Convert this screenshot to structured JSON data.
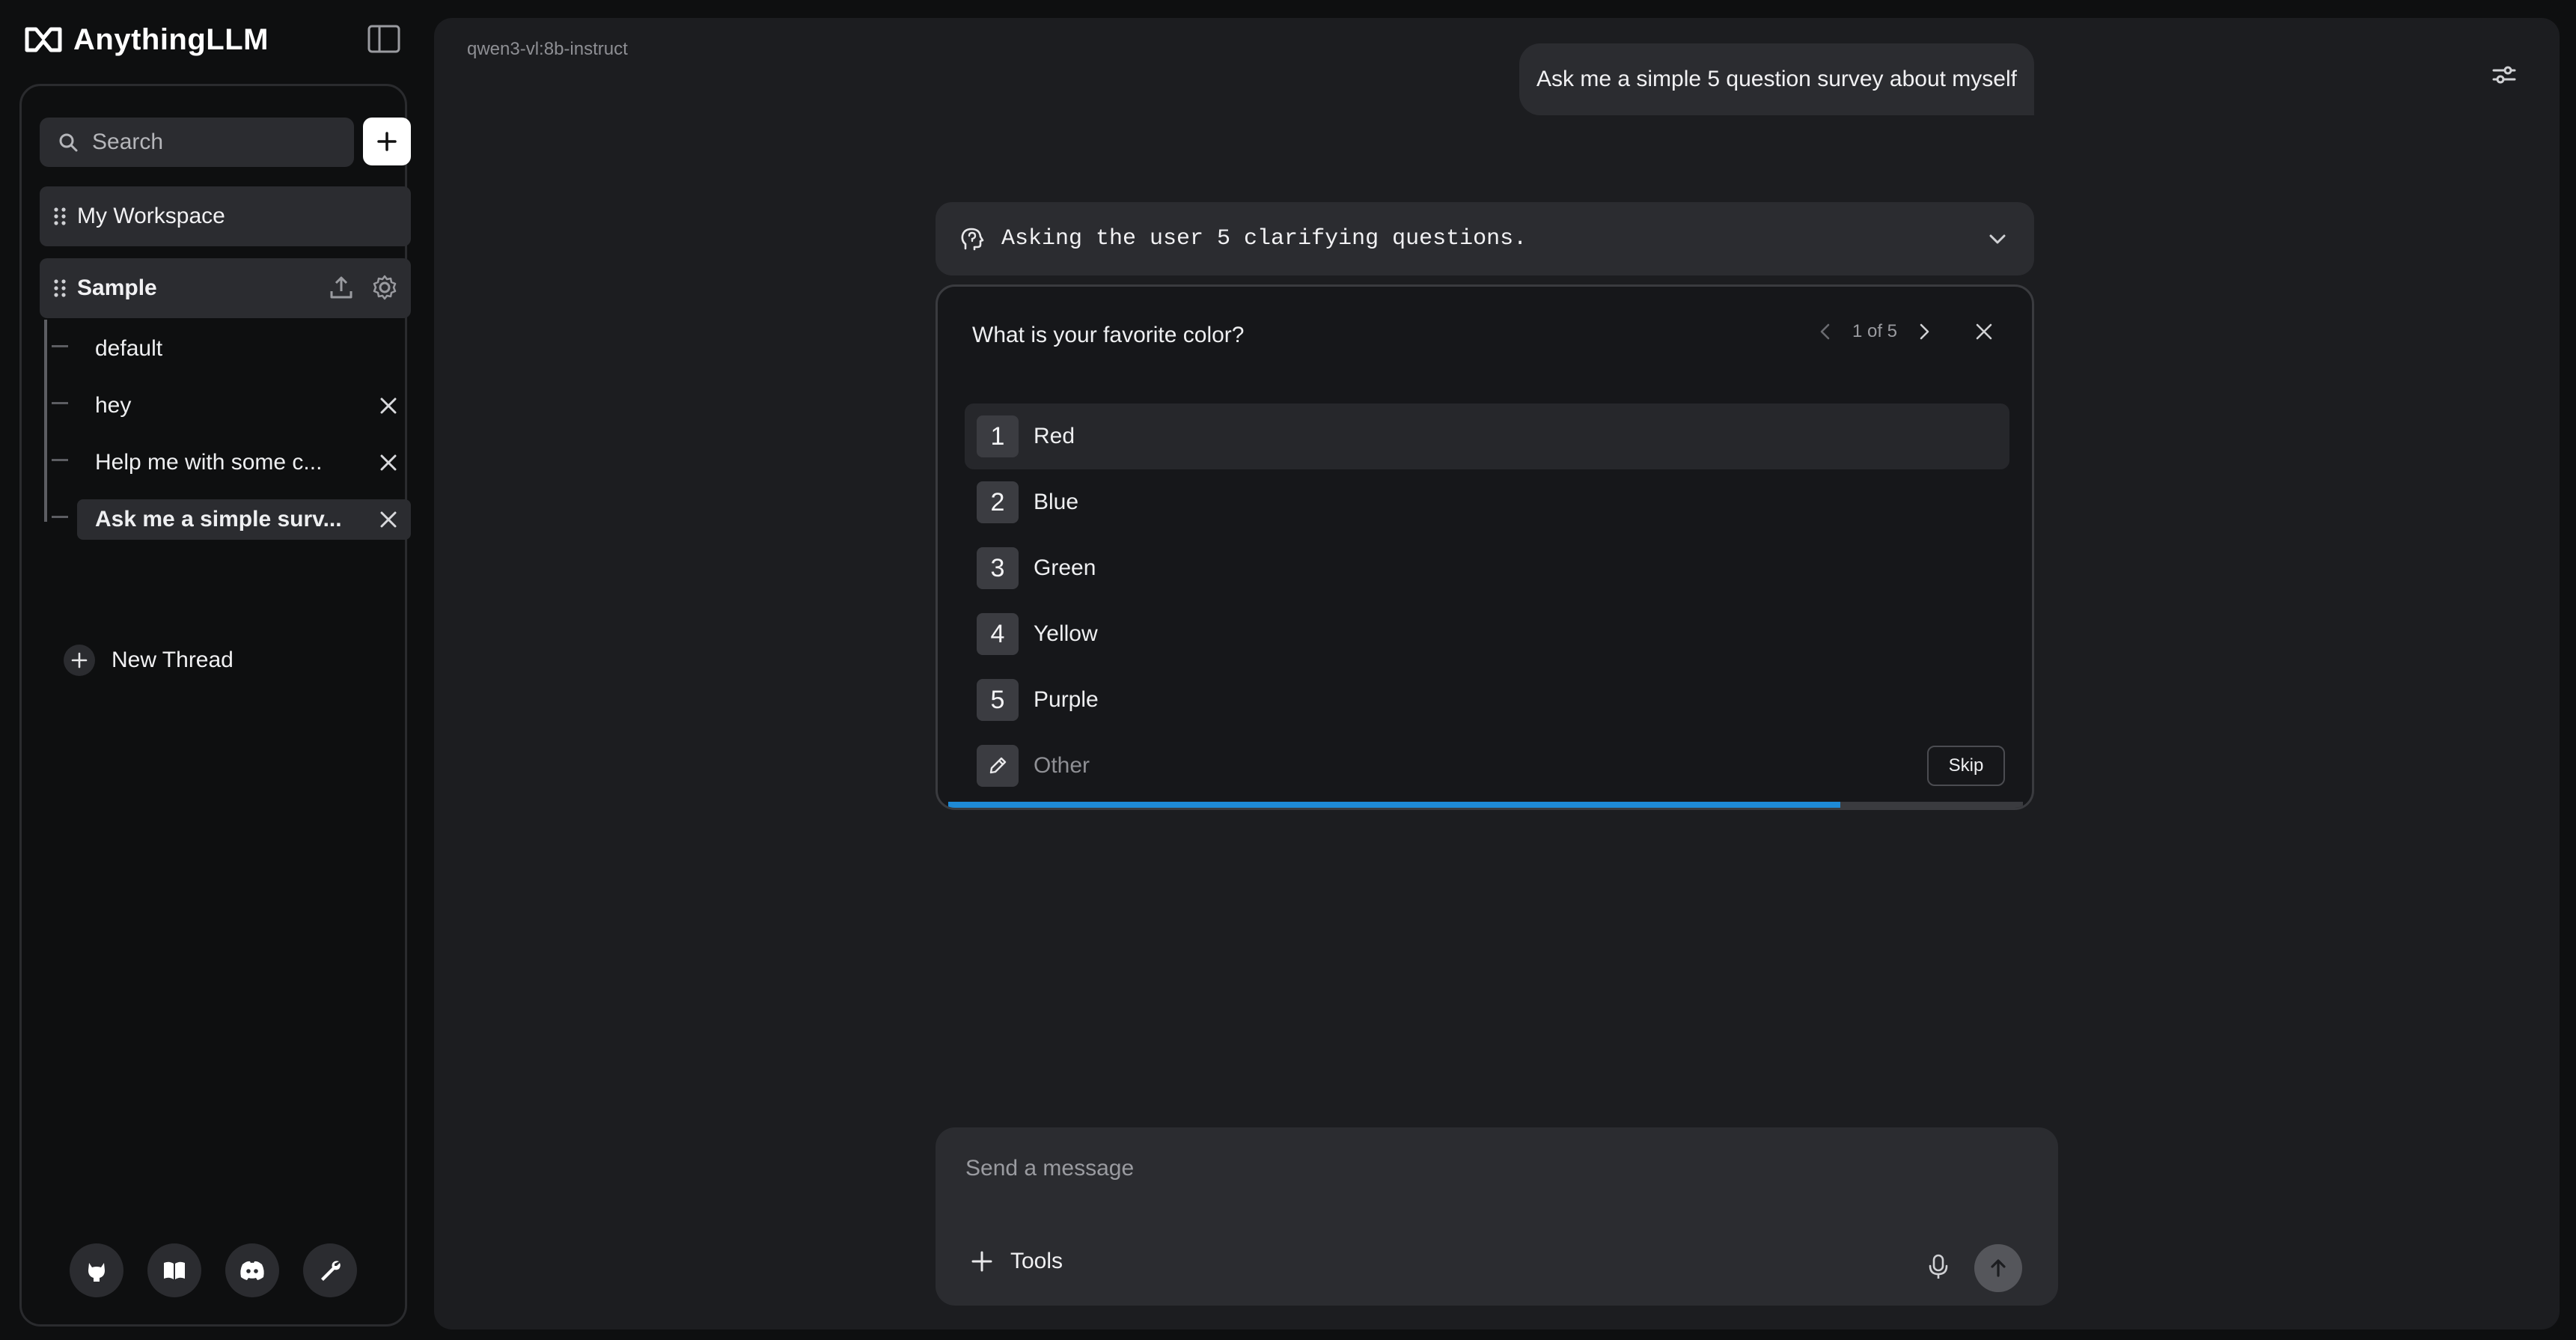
{
  "app": {
    "title": "AnythingLLM"
  },
  "sidebar": {
    "search": {
      "placeholder": "Search"
    },
    "workspaces": [
      {
        "label": "My Workspace"
      },
      {
        "label": "Sample"
      }
    ],
    "threads": [
      {
        "label": "default",
        "closable": false,
        "active": false
      },
      {
        "label": "hey",
        "closable": true,
        "active": false
      },
      {
        "label": "Help me with some c...",
        "closable": true,
        "active": false
      },
      {
        "label": "Ask me a simple surv...",
        "closable": true,
        "active": true
      }
    ],
    "new_thread_label": "New Thread",
    "footer_icons": [
      "github-icon",
      "docs-book-icon",
      "discord-icon",
      "wrench-icon"
    ]
  },
  "main": {
    "model_label": "qwen3-vl:8b-instruct",
    "user_message": "Ask me a simple 5 question survey about myself",
    "thought": "Asking the user 5 clarifying questions.",
    "survey": {
      "question": "What is your favorite color?",
      "pager": "1 of 5",
      "options": [
        {
          "num": "1",
          "label": "Red"
        },
        {
          "num": "2",
          "label": "Blue"
        },
        {
          "num": "3",
          "label": "Green"
        },
        {
          "num": "4",
          "label": "Yellow"
        },
        {
          "num": "5",
          "label": "Purple"
        }
      ],
      "other_label": "Other",
      "skip_label": "Skip",
      "progress": 0.83
    },
    "composer": {
      "placeholder": "Send a message",
      "tools_label": "Tools"
    }
  },
  "colors": {
    "background": "#0e0f10",
    "panel": "#1c1d20",
    "surface": "#2b2c30",
    "accent": "#1e8ad6"
  }
}
